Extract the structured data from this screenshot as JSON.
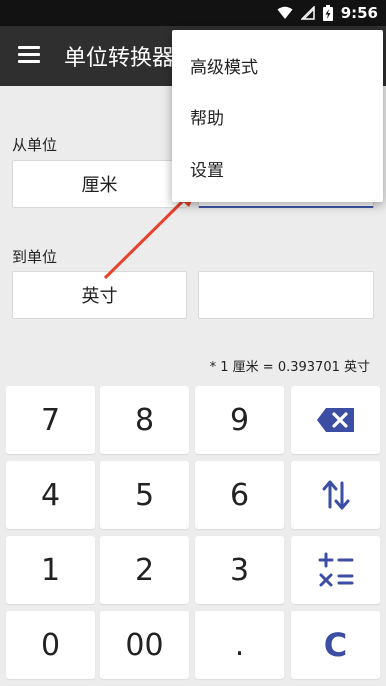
{
  "status_bar": {
    "time": "9:56"
  },
  "app_bar": {
    "title": "单位转换器"
  },
  "from": {
    "section_label": "从单位",
    "unit": "厘米",
    "value": ""
  },
  "to": {
    "section_label": "到单位",
    "unit": "英寸",
    "value": ""
  },
  "formula": "* 1 厘米 = 0.393701 英寸",
  "keypad": {
    "rows": [
      [
        "7",
        "8",
        "9"
      ],
      [
        "4",
        "5",
        "6"
      ],
      [
        "1",
        "2",
        "3"
      ],
      [
        "0",
        "00",
        "."
      ]
    ],
    "actions": {
      "backspace": "backspace-icon",
      "swap": "swap-icon",
      "operators": "operators-icon",
      "clear": "C"
    }
  },
  "dropdown_menu": {
    "items": [
      "高级模式",
      "帮助",
      "设置"
    ]
  },
  "colors": {
    "accent": "#3b4ea3",
    "app_bar": "#2f2f2f",
    "status_bar": "#121212",
    "arrow": "#e8412c",
    "background": "#ececec"
  }
}
